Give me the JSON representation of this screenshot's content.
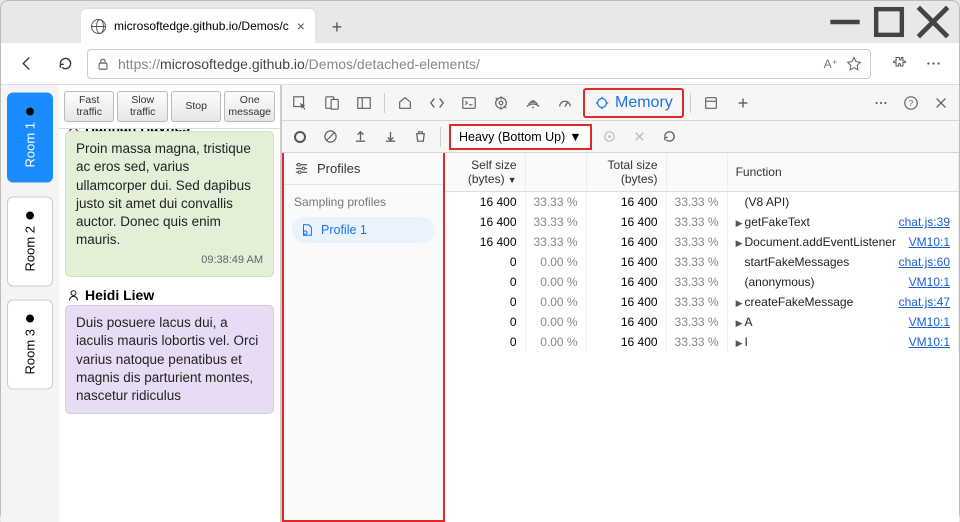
{
  "browser": {
    "tab_title": "microsoftedge.github.io/Demos/c",
    "url_host": "microsoftedge.github.io",
    "url_prefix": "https://",
    "url_path": "/Demos/detached-elements/"
  },
  "rooms": [
    {
      "label": "Room 1",
      "active": true
    },
    {
      "label": "Room 2",
      "active": false
    },
    {
      "label": "Room 3",
      "active": false
    }
  ],
  "chat_buttons": {
    "fast": "Fast\ntraffic",
    "slow": "Slow\ntraffic",
    "stop": "Stop",
    "one": "One\nmessage"
  },
  "messages": [
    {
      "user": "Hannah Haynes",
      "cut": true,
      "color": "green",
      "body": "Proin massa magna, tristique ac eros sed, varius ullamcorper dui. Sed dapibus justo sit amet dui convallis auctor. Donec quis enim mauris.",
      "time": "09:38:49 AM"
    },
    {
      "user": "Heidi Liew",
      "cut": false,
      "color": "purple",
      "body": "Duis posuere lacus dui, a iaculis mauris lobortis vel. Orci varius natoque penatibus et magnis dis parturient montes, nascetur ridiculus",
      "time": ""
    }
  ],
  "devtools": {
    "memory_label": "Memory",
    "view_label": "Heavy (Bottom Up)",
    "profiles_header": "Profiles",
    "profiles_sub": "Sampling profiles",
    "profile_item": "Profile 1",
    "columns": {
      "self": "Self size (bytes)",
      "total": "Total size (bytes)",
      "fn": "Function"
    },
    "rows": [
      {
        "self": "16 400",
        "selfp": "33.33 %",
        "total": "16 400",
        "totalp": "33.33 %",
        "fn": "(V8 API)",
        "expand": false,
        "src": ""
      },
      {
        "self": "16 400",
        "selfp": "33.33 %",
        "total": "16 400",
        "totalp": "33.33 %",
        "fn": "getFakeText",
        "expand": true,
        "src": "chat.js:39"
      },
      {
        "self": "16 400",
        "selfp": "33.33 %",
        "total": "16 400",
        "totalp": "33.33 %",
        "fn": "Document.addEventListener",
        "expand": true,
        "src": "VM10:1"
      },
      {
        "self": "0",
        "selfp": "0.00 %",
        "total": "16 400",
        "totalp": "33.33 %",
        "fn": "startFakeMessages",
        "expand": false,
        "src": "chat.js:60"
      },
      {
        "self": "0",
        "selfp": "0.00 %",
        "total": "16 400",
        "totalp": "33.33 %",
        "fn": "(anonymous)",
        "expand": false,
        "src": "VM10:1"
      },
      {
        "self": "0",
        "selfp": "0.00 %",
        "total": "16 400",
        "totalp": "33.33 %",
        "fn": "createFakeMessage",
        "expand": true,
        "src": "chat.js:47"
      },
      {
        "self": "0",
        "selfp": "0.00 %",
        "total": "16 400",
        "totalp": "33.33 %",
        "fn": "A",
        "expand": true,
        "src": "VM10:1"
      },
      {
        "self": "0",
        "selfp": "0.00 %",
        "total": "16 400",
        "totalp": "33.33 %",
        "fn": "I",
        "expand": true,
        "src": "VM10:1"
      }
    ]
  }
}
